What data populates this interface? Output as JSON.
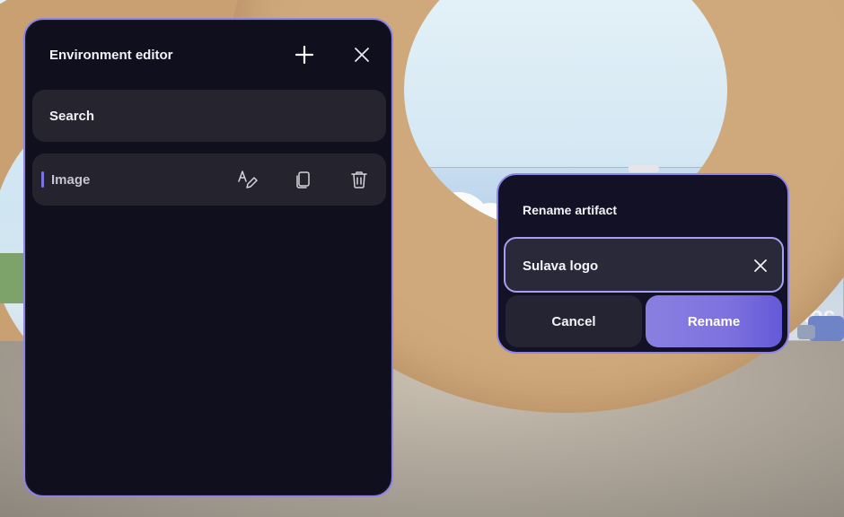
{
  "editor": {
    "title": "Environment editor",
    "add_icon": "plus-icon",
    "close_icon": "close-icon",
    "search": {
      "label": "Search"
    },
    "items": [
      {
        "label": "Image",
        "icons": [
          "rename-icon",
          "copy-icon",
          "delete-icon"
        ]
      }
    ]
  },
  "rename_dialog": {
    "title": "Rename artifact",
    "input_value": "Sulava logo",
    "clear_icon": "close-icon",
    "cancel_label": "Cancel",
    "rename_label": "Rename"
  },
  "scene": {
    "banner_text": "rhoc",
    "banner_letters": "V"
  },
  "colors": {
    "panel_bg": "#0f0f1e",
    "panel_border": "#8d84e6",
    "accent": "#7c74e2",
    "primary_button": "#7d72df"
  }
}
